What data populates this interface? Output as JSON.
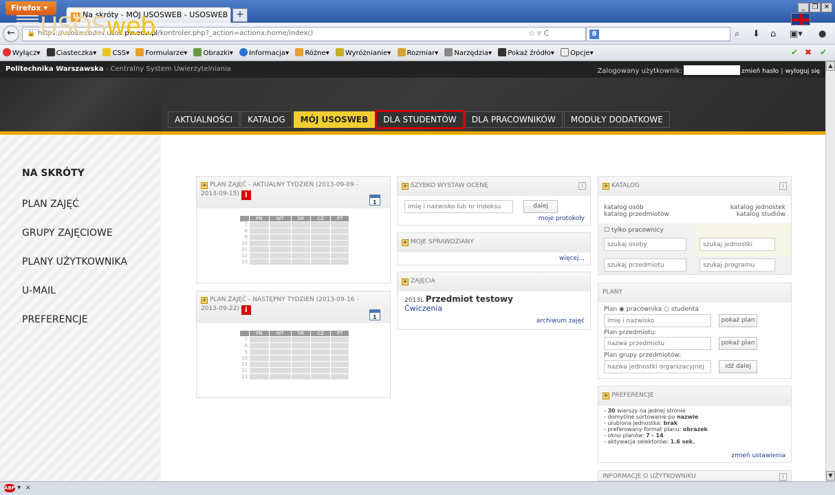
{
  "browser": {
    "ff_label": "Firefox",
    "tab_title": "Na skróty - MÓJ USOSWEB - USOSWEB PW ...",
    "url_prefix": "https://usoswebdev.usos.",
    "url_domain": "pw.edu.pl",
    "url_suffix": "/kontroler.php?_action=actionx:home/index()",
    "status_close": "×"
  },
  "toolbar": {
    "items": [
      "Wyłącz▾",
      "Ciasteczka▾",
      "CSS▾",
      "Formularze▾",
      "Obrazki▾",
      "Informacja▾",
      "Różne▾",
      "Wyróżnianie▾",
      "Rozmiar▾",
      "Narzędzia▾",
      "Pokaż źródło▾",
      "Opcje▾"
    ]
  },
  "site": {
    "org": "Politechnika Warszawska",
    "subtitle": " - Centralny System Uwierzytelniania",
    "logged_label": "Zalogowany użytkownik:",
    "change_password": "zmień hasło",
    "separator": "|",
    "logout": "wyloguj się",
    "logo_a": "USOS",
    "logo_b": "web"
  },
  "menu": [
    "AKTUALNOŚCI",
    "KATALOG",
    "MÓJ USOSWEB",
    "DLA STUDENTÓW",
    "DLA PRACOWNIKÓW",
    "MODUŁY DODATKOWE"
  ],
  "sidebar": {
    "title": "NA SKRÓTY",
    "items": [
      "PLAN ZAJĘĆ",
      "GRUPY ZAJĘCIOWE",
      "PLANY UŻYTKOWNIKA",
      "U-MAIL",
      "PREFERENCJE"
    ]
  },
  "plan1": {
    "title_a": "PLAN ZAJĘĆ - AKTUALNY TYDZIEŃ (2013-09-09 -",
    "title_b": "2013-09-15)"
  },
  "plan2": {
    "title_a": "PLAN ZAJĘĆ - NASTĘPNY TYDZIEŃ (2013-09-16 -",
    "title_b": "2013-09-22)"
  },
  "days": [
    "PN",
    "WT",
    "ŚR",
    "CZ",
    "PT"
  ],
  "hours": [
    "7",
    "8",
    "9",
    "10",
    "11",
    "12",
    "13"
  ],
  "cal_day": "1",
  "grade": {
    "title": "SZYBKO WYSTAW OCENĘ",
    "placeholder": "imię i nazwisko lub nr indeksu",
    "button": "dalej",
    "link": "moje protokoły"
  },
  "tests": {
    "title": "MOJE SPRAWDZIANY",
    "link": "więcej..."
  },
  "classes": {
    "title": "ZAJĘCIA",
    "term": "2013L",
    "course": "Przedmiot testowy",
    "type": "Ćwiczenia",
    "link": "archiwum zajęć"
  },
  "catalog": {
    "title": "KATALOG",
    "l1": "katalog osób",
    "l2": "katalog przedmiotów",
    "r1": "katalog jednostek",
    "r2": "katalog studiów",
    "checkbox": "tylko pracownicy",
    "p1": "szukaj osoby",
    "p2": "szukaj jednostki",
    "p3": "szukaj przedmiotu",
    "p4": "szukaj programu"
  },
  "plans": {
    "title": "PLANY",
    "plan_label": "Plan",
    "opt1": "pracownika",
    "opt2": "studenta",
    "p_name": "imię i nazwisko",
    "btn_show": "pokaż plan",
    "subject_label": "Plan przedmiotu:",
    "p_subject": "nazwa przedmiotu",
    "group_label": "Plan grupy przedmiotów:",
    "p_unit": "nazwa jednostki organizacyjnej",
    "btn_go": "idź dalej"
  },
  "prefs": {
    "title": "PREFERENCJE",
    "lines": [
      {
        "pre": "- ",
        "b": "30",
        "post": " wierszy na jednej stronie"
      },
      {
        "pre": "- domyślne sortowanie po ",
        "b": "nazwie",
        "post": ""
      },
      {
        "pre": "- ulubiona jednostka: ",
        "b": "brak",
        "post": ""
      },
      {
        "pre": "- preferowany format planu: ",
        "b": "obrazek",
        "post": ""
      },
      {
        "pre": "- okno planów: ",
        "b": "7 - 14",
        "post": ""
      },
      {
        "pre": "- aktywacja selektorów: ",
        "b": "1.6 sek.",
        "post": ""
      }
    ],
    "link": "zmień ustawienia"
  },
  "userinfo": {
    "title": "INFORMACJE O UŻYTKOWNIKU"
  }
}
